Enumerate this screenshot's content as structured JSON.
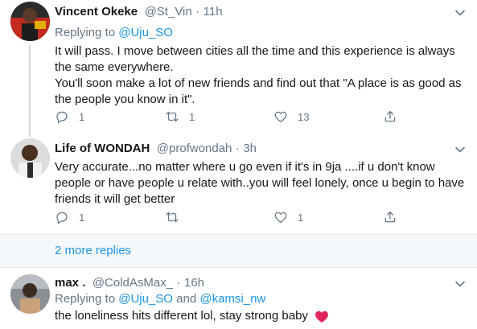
{
  "tweets": [
    {
      "name": "Vincent Okeke",
      "handle": "@St_Vin",
      "sep": "·",
      "time": "11h",
      "replying_prefix": "Replying to",
      "mentions": [
        "@Uju_SO"
      ],
      "paragraphs": [
        "It will pass. I move between cities all the time and this experience is always the same everywhere.",
        "You'll soon make a lot of new friends and find out that \"A place is as good as the people you know in it\"."
      ],
      "counts": {
        "reply": "1",
        "retweet": "1",
        "like": "13"
      }
    },
    {
      "name": "Life of WONDAH",
      "handle": "@profwondah",
      "sep": "·",
      "time": "3h",
      "paragraphs": [
        "Very accurate...no matter where u go even if it's in 9ja ....if u don't know people or have people u relate with..you will feel lonely, once u begin to have friends it will get better"
      ],
      "counts": {
        "reply": "1",
        "retweet": "",
        "like": "1"
      }
    },
    {
      "name": "max .",
      "handle": "@ColdAsMax_",
      "sep": "·",
      "time": "16h",
      "replying_prefix": "Replying to",
      "mentions": [
        "@Uju_SO",
        "@kamsi_nw"
      ],
      "mention_joiner": "and",
      "paragraphs": [
        "the loneliness hits different lol, stay strong baby"
      ]
    }
  ],
  "more_replies": "2 more replies",
  "icons": {
    "reply": "reply-icon",
    "retweet": "retweet-icon",
    "like": "like-icon",
    "share": "share-icon",
    "more": "chevron-down-icon",
    "heart": "red-heart-emoji"
  },
  "colors": {
    "link": "#1b95e0",
    "secondary": "#657786",
    "heart": "#e0245e",
    "thread_line": "#ccd6dd",
    "more_bar_bg": "#f5f8fa"
  }
}
